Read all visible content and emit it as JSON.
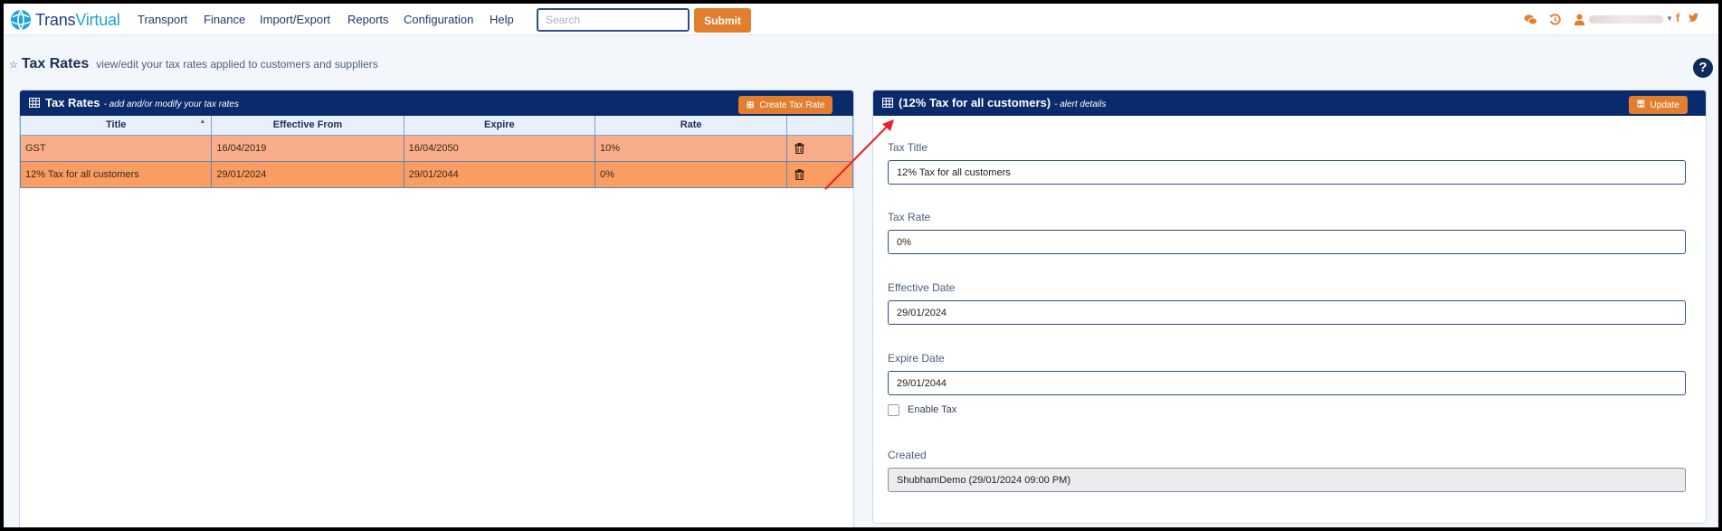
{
  "brand": {
    "part1": "Trans",
    "part2": "Virtual"
  },
  "nav": [
    "Transport",
    "Finance",
    "Import/Export",
    "Reports",
    "Configuration",
    "Help"
  ],
  "search": {
    "placeholder": "Search",
    "value": ""
  },
  "submit_label": "Submit",
  "header_icons": [
    "chat-icon",
    "history-icon",
    "user-icon",
    "facebook-icon",
    "twitter-icon"
  ],
  "page": {
    "title": "Tax Rates",
    "subtitle": "view/edit your tax rates applied to customers and suppliers"
  },
  "list_panel": {
    "title": "Tax Rates",
    "subtitle": "- add and/or modify your tax rates",
    "create_label": "Create Tax Rate",
    "columns": [
      "Title",
      "Effective From",
      "Expire",
      "Rate",
      ""
    ],
    "rows": [
      {
        "title": "GST",
        "effective_from": "16/04/2019",
        "expire": "16/04/2050",
        "rate": "10%"
      },
      {
        "title": "12% Tax for all customers",
        "effective_from": "29/01/2024",
        "expire": "29/01/2044",
        "rate": "0%"
      }
    ]
  },
  "detail_panel": {
    "title": "(12% Tax for all customers)",
    "subtitle": "- alert details",
    "update_label": "Update",
    "fields": {
      "tax_title": {
        "label": "Tax Title",
        "value": "12% Tax for all customers"
      },
      "tax_rate": {
        "label": "Tax Rate",
        "value": "0%"
      },
      "effective_date": {
        "label": "Effective Date",
        "value": "29/01/2024"
      },
      "expire_date": {
        "label": "Expire Date",
        "value": "29/01/2044"
      },
      "enable_tax": {
        "label": "Enable Tax",
        "checked": false
      },
      "created": {
        "label": "Created",
        "value": "ShubhamDemo (29/01/2024 09:00 PM)"
      }
    }
  },
  "colors": {
    "nav_bg": "#0a2b6b",
    "accent": "#e27e2e",
    "row_normal": "#f9ad88",
    "row_selected": "#f99d62",
    "annotation_arrow": "#e8202a"
  }
}
